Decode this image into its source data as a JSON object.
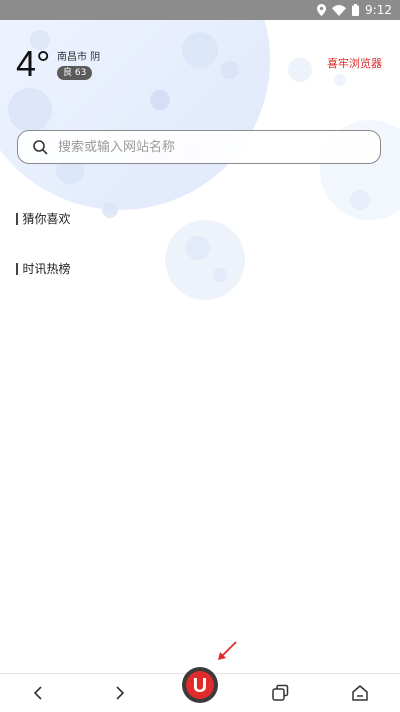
{
  "status_bar": {
    "time": "9:12",
    "icons": [
      "location-icon",
      "wifi-icon",
      "battery-icon"
    ],
    "background_color": "#8c8c8c"
  },
  "weather": {
    "temperature": "4°",
    "city_condition": "南昌市 阴",
    "air_quality": "良 63"
  },
  "brand": {
    "name": "喜牢浏览器",
    "color": "#e02b2b"
  },
  "search": {
    "placeholder": "搜索或输入网站名称",
    "value": ""
  },
  "sections": [
    {
      "label": "猜你喜欢"
    },
    {
      "label": "时讯热榜"
    }
  ],
  "bottom_nav": {
    "items": [
      "back-icon",
      "forward-icon",
      "uc-logo-icon",
      "tabs-icon",
      "home-icon"
    ],
    "logo_letter": "U",
    "logo_color": "#e02b2b"
  }
}
